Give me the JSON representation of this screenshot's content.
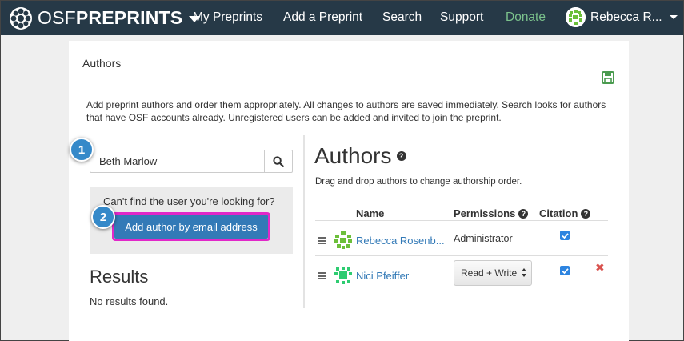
{
  "navbar": {
    "brand_osf": "OSF",
    "brand_preprints": "PREPRINTS",
    "links": {
      "my_preprints": "My Preprints",
      "add_preprint": "Add a Preprint",
      "search": "Search",
      "support": "Support",
      "donate": "Donate"
    },
    "user_name": "Rebecca R...",
    "donate_color": "#7bc28c"
  },
  "section": {
    "title": "Authors",
    "intro": "Add preprint authors and order them appropriately. All changes to authors are saved immediately. Search looks for authors that have OSF accounts already. Unregistered users can be added and invited to join the preprint."
  },
  "search": {
    "value": "Beth Marlow",
    "icon": "search-icon"
  },
  "cant_find": {
    "text": "Can't find the user you're looking for?",
    "button": "Add author by email address"
  },
  "results": {
    "title": "Results",
    "empty": "No results found."
  },
  "callouts": [
    "1",
    "2"
  ],
  "authors": {
    "heading": "Authors",
    "hint": "Drag and drop authors to change authorship order.",
    "columns": {
      "name": "Name",
      "permissions": "Permissions",
      "citation": "Citation"
    },
    "rows": [
      {
        "name": "Rebecca Rosenb...",
        "permission": "Administrator",
        "citation": true
      },
      {
        "name": "Nici Pfeiffer",
        "permission": "Read + Write",
        "citation": true
      }
    ]
  },
  "colors": {
    "navbar": "#263947",
    "primary": "#337ab7",
    "highlight": "#e128c8",
    "callout": "#3589c9",
    "remove": "#d9534f"
  }
}
